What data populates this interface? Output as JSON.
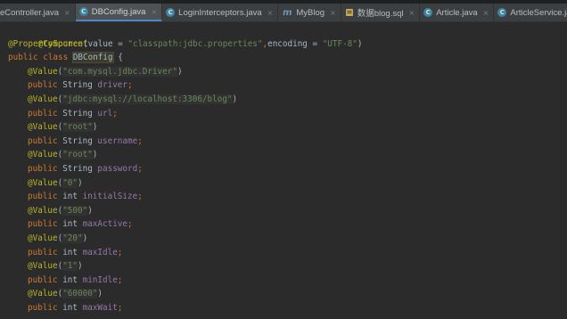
{
  "tabs": [
    {
      "icon": "",
      "label": "eController.java",
      "active": false
    },
    {
      "icon": "C",
      "label": "DBConfig.java",
      "active": true
    },
    {
      "icon": "C",
      "label": "LoginInterceptors.java",
      "active": false
    },
    {
      "icon": "m",
      "label": "MyBlog",
      "active": false
    },
    {
      "icon": "sql",
      "label": "数据blog.sql",
      "active": false
    },
    {
      "icon": "C",
      "label": "Article.java",
      "active": false
    },
    {
      "icon": "C",
      "label": "ArticleService.java",
      "active": false
    }
  ],
  "tab_close_symbol": "×",
  "code": {
    "l1": {
      "annotation": "@Component"
    },
    "l2": {
      "annotation": "@PropertySource",
      "open": "(",
      "key1": "value",
      "eq1": " = ",
      "val1": "\"classpath:jdbc.properties\"",
      "comma": ",",
      "key2": "encoding",
      "eq2": " = ",
      "val2": "\"UTF-8\"",
      "close": ")"
    },
    "l3": {
      "kw1": "public",
      "kw2": "class",
      "name": "DBConfig",
      "brace": " {"
    },
    "fields": [
      {
        "annotation": "@Value",
        "arg": "\"com.mysql.jdbc.Driver\"",
        "mod": "public",
        "type": "String",
        "name": "driver"
      },
      {
        "annotation": "@Value",
        "arg": "\"jdbc:mysql://localhost:3306/blog\"",
        "mod": "public",
        "type": "String",
        "name": "url"
      },
      {
        "annotation": "@Value",
        "arg": "\"root\"",
        "mod": "public",
        "type": "String",
        "name": "username"
      },
      {
        "annotation": "@Value",
        "arg": "\"root\"",
        "mod": "public",
        "type": "String",
        "name": "password"
      },
      {
        "annotation": "@Value",
        "arg": "\"0\"",
        "mod": "public",
        "type": "int",
        "name": "initialSize"
      },
      {
        "annotation": "@Value",
        "arg": "\"500\"",
        "mod": "public",
        "type": "int",
        "name": "maxActive"
      },
      {
        "annotation": "@Value",
        "arg": "\"20\"",
        "mod": "public",
        "type": "int",
        "name": "maxIdle"
      },
      {
        "annotation": "@Value",
        "arg": "\"1\"",
        "mod": "public",
        "type": "int",
        "name": "minIdle"
      },
      {
        "annotation": "@Value",
        "arg": "\"60000\"",
        "mod": "public",
        "type": "int",
        "name": "maxWait"
      }
    ],
    "paren_open": "(",
    "paren_close": ")",
    "semicolon": ";"
  },
  "colors": {
    "background": "#2b2b2b",
    "annotation": "#bbb529",
    "keyword": "#cc7832",
    "string": "#6a8759",
    "field": "#9876aa",
    "text": "#a9b7c6"
  }
}
